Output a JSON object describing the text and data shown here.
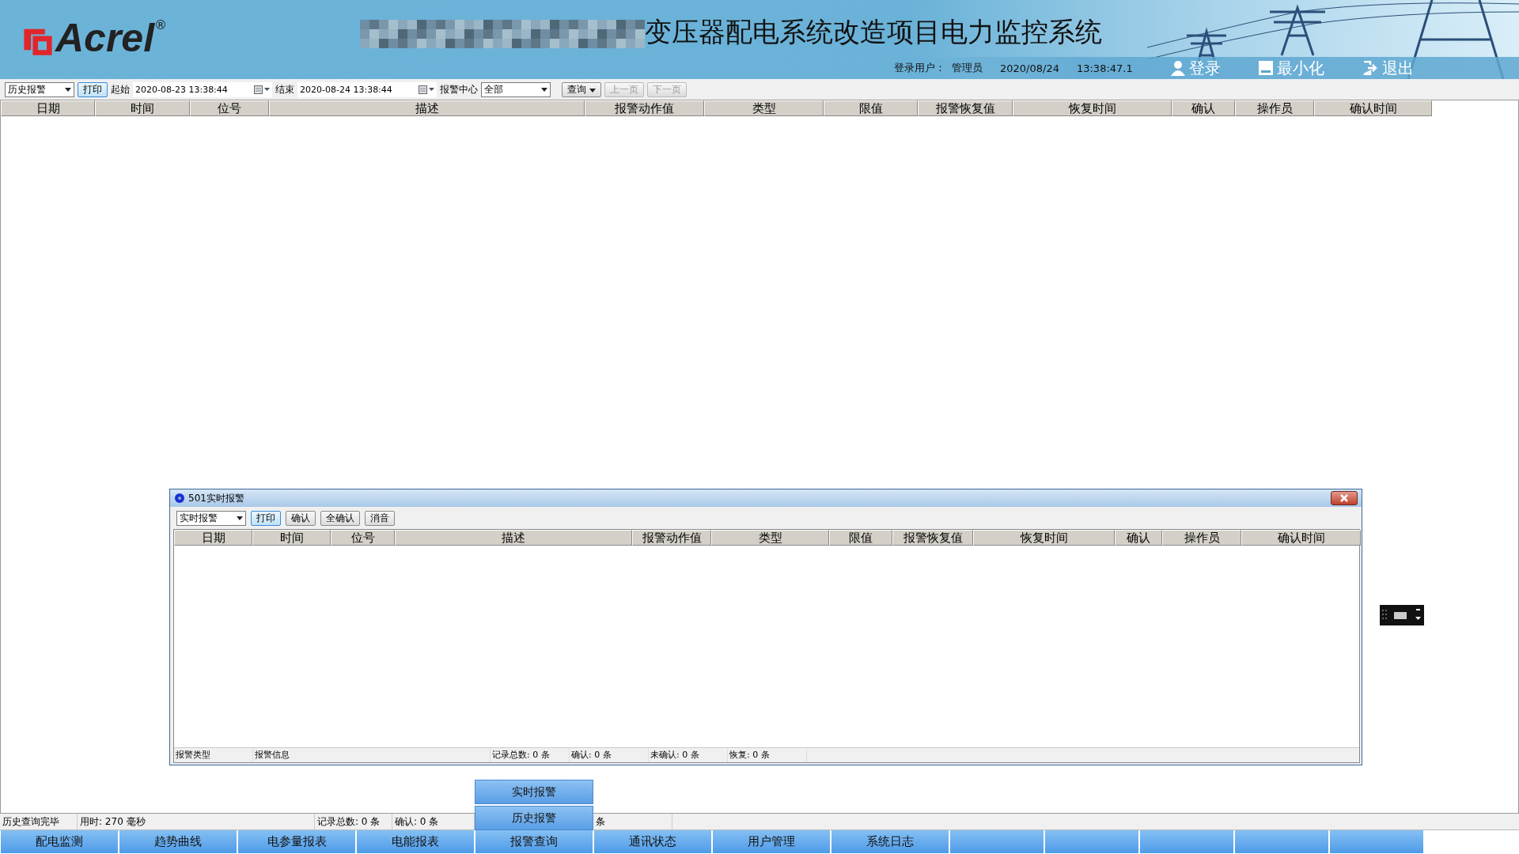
{
  "header": {
    "logo": "Acrel",
    "logo_mark": "®",
    "title": "变压器配电系统改造项目电力监控系统",
    "user_label": "登录用户：",
    "user": "管理员",
    "date": "2020/08/24",
    "time": "13:38:47.1",
    "actions": [
      {
        "kind": "login",
        "label": "登录"
      },
      {
        "kind": "minimize",
        "label": "最小化"
      },
      {
        "kind": "exit",
        "label": "退出"
      }
    ]
  },
  "toolbar": {
    "mode": "历史报警",
    "print": "打印",
    "start_label": "起始",
    "start": "2020-08-23 13:38:44",
    "end_label": "结束",
    "end": "2020-08-24 13:38:44",
    "center_label": "报警中心",
    "center": "全部",
    "query": "查询",
    "pager": [
      {
        "label": "上一页",
        "disabled": true
      },
      {
        "label": "下一页",
        "disabled": true
      }
    ]
  },
  "table": {
    "columns": [
      "日期",
      "时间",
      "位号",
      "描述",
      "报警动作值",
      "类型",
      "限值",
      "报警恢复值",
      "恢复时间",
      "确认",
      "操作员",
      "确认时间"
    ]
  },
  "popup": {
    "title": "501实时报警",
    "mode": "实时报警",
    "buttons": [
      "打印",
      "确认",
      "全确认",
      "消音"
    ],
    "columns": [
      "日期",
      "时间",
      "位号",
      "描述",
      "报警动作值",
      "类型",
      "限值",
      "报警恢复值",
      "恢复时间",
      "确认",
      "操作员",
      "确认时间"
    ],
    "status": [
      "报警类型",
      "报警信息",
      "记录总数: 0 条",
      "确认: 0 条",
      "未确认: 0 条",
      "恢复: 0 条"
    ]
  },
  "floating_buttons": [
    "实时报警",
    "历史报警"
  ],
  "status_bar": [
    "历史查询完毕",
    "用时: 270 毫秒",
    "记录总数: 0 条",
    "确认: 0 条",
    "条"
  ],
  "nav_tabs": [
    "配电监测",
    "趋势曲线",
    "电参量报表",
    "电能报表",
    "报警查询",
    "通讯状态",
    "用户管理",
    "系统日志"
  ]
}
